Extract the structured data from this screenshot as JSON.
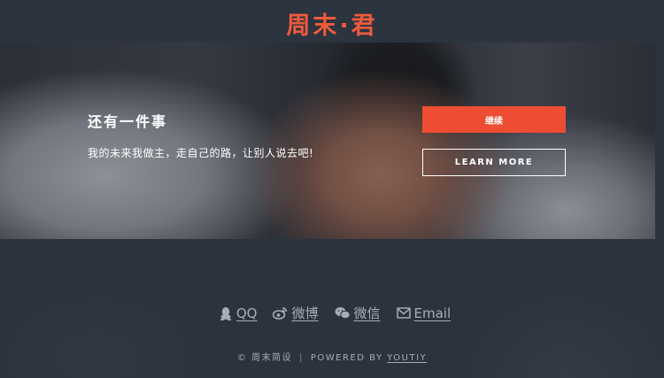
{
  "header": {
    "brand": "周末·君"
  },
  "hero": {
    "title": "还有一件事",
    "subtitle": "我的未来我做主，走自己的路，让别人说去吧!",
    "primary_button": "继续",
    "secondary_button": "LEARN MORE"
  },
  "footer": {
    "social": [
      {
        "label": "QQ",
        "icon": "qq-icon"
      },
      {
        "label": "微博",
        "icon": "weibo-icon"
      },
      {
        "label": "微信",
        "icon": "wechat-icon"
      },
      {
        "label": "Email",
        "icon": "envelope-icon"
      }
    ],
    "copyright": "© 周末简设",
    "powered_prefix": "POWERED BY",
    "powered_link": "YOUTIY"
  },
  "colors": {
    "accent": "#ef4d33",
    "brand": "#ef5b3c",
    "background": "#2b333d",
    "muted_text": "#a8adb5"
  }
}
